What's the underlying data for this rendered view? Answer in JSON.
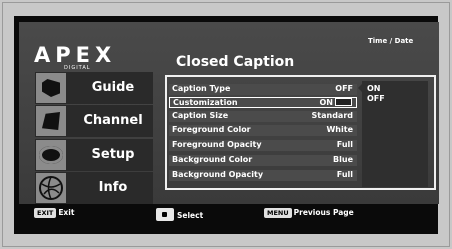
{
  "brand": {
    "logo": "APEX",
    "logo_sub": "DIGITAL"
  },
  "header": {
    "time_date": "Time / Date",
    "title": "Closed Caption"
  },
  "sidebar": {
    "items": [
      {
        "label": "Guide",
        "icon": "guide-icon"
      },
      {
        "label": "Channel",
        "icon": "channel-icon"
      },
      {
        "label": "Setup",
        "icon": "setup-icon"
      },
      {
        "label": "Info",
        "icon": "info-icon"
      }
    ]
  },
  "menu": {
    "rows": [
      {
        "label": "Caption Type",
        "value": "OFF"
      },
      {
        "label": "Customization",
        "value": "ON",
        "selected": true
      },
      {
        "label": "Caption Size",
        "value": "Standard"
      },
      {
        "label": "Foreground Color",
        "value": "White"
      },
      {
        "label": "Foreground Opacity",
        "value": "Full"
      },
      {
        "label": "Background Color",
        "value": "Blue"
      },
      {
        "label": "Background Opacity",
        "value": "Full"
      }
    ]
  },
  "options": [
    "ON",
    "OFF"
  ],
  "footer": {
    "exit_key": "EXIT",
    "exit_label": "Exit",
    "select_label": "Select",
    "menu_key": "MENU",
    "menu_label": "Previous Page"
  }
}
